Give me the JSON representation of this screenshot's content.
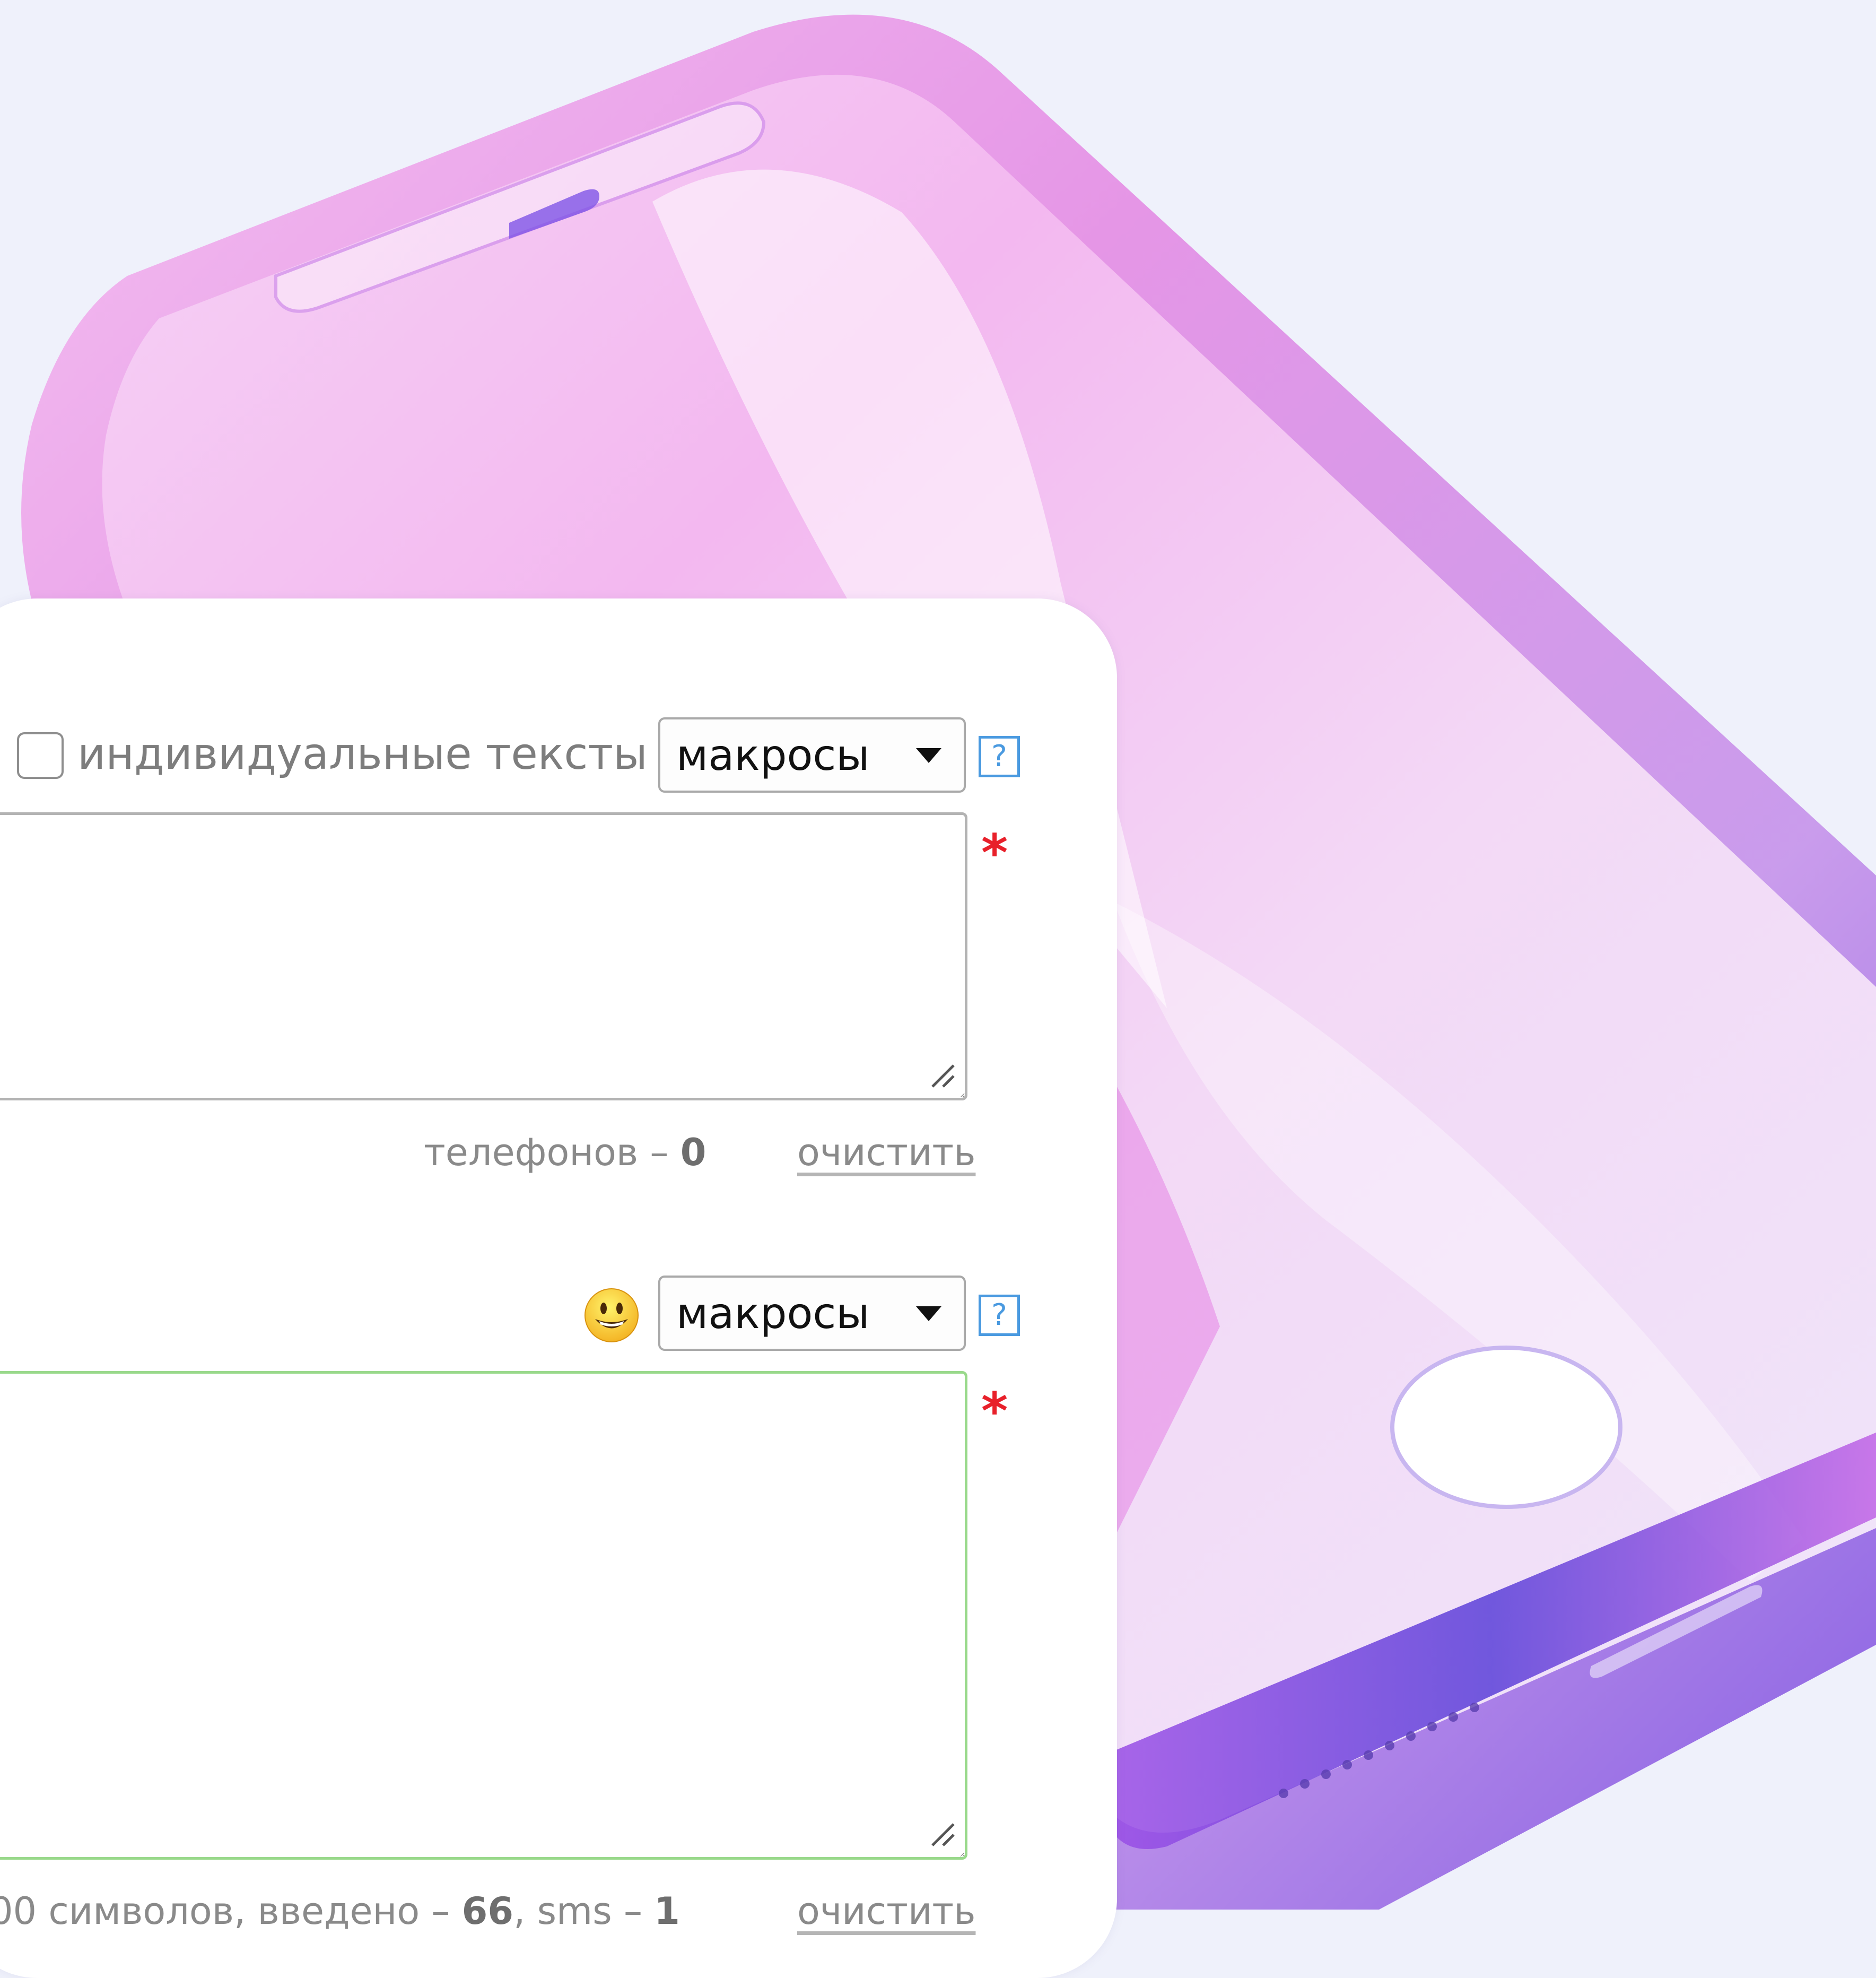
{
  "recipients": {
    "individual_texts_label": "индивидуальные тексты",
    "individual_texts_checked": false,
    "macros_select": {
      "selected": "макросы"
    },
    "help_label": "?",
    "required_mark": "*",
    "phones_label": "телефонов – ",
    "phones_count": "0",
    "clear_label": "очистить"
  },
  "message": {
    "emoji_button": "smiley-icon",
    "macros_select": {
      "selected": "макросы"
    },
    "help_label": "?",
    "required_mark": "*",
    "chars_prefix": "00 символов, введено – ",
    "chars_count": "66",
    "sms_prefix": ", sms – ",
    "sms_count": "1",
    "clear_label": "очистить"
  },
  "colors": {
    "background": "#eff1fb",
    "accent_help": "#4a9ae0",
    "required": "#e8202a",
    "message_border_valid": "#99d98b"
  }
}
